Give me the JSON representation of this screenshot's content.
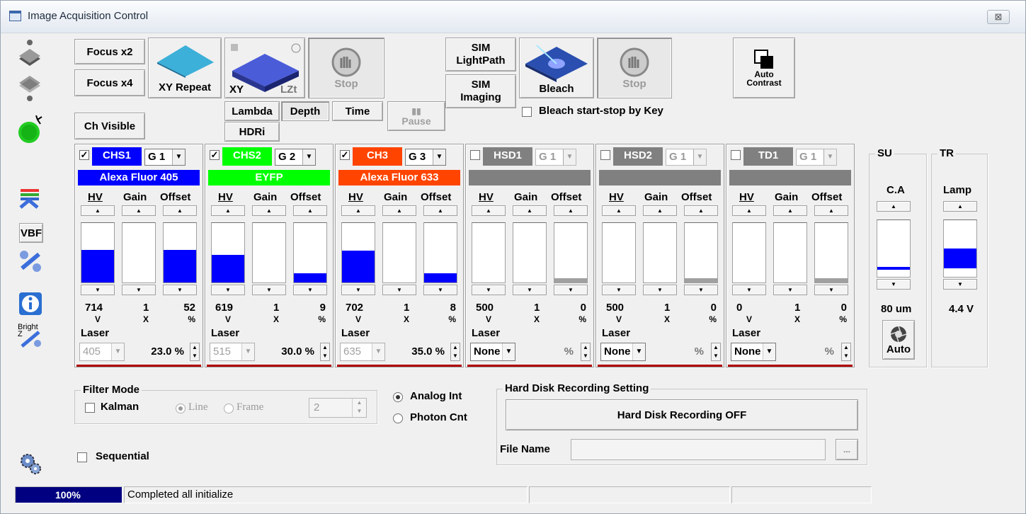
{
  "window": {
    "title": "Image Acquisition Control",
    "close_glyph": "⊠"
  },
  "toolbar": {
    "focus_x2": "Focus x2",
    "focus_x4": "Focus x4",
    "xy_repeat": "XY Repeat",
    "xy": "XY",
    "lzt": "LZt",
    "stop": "Stop",
    "sim_lightpath_1": "SIM",
    "sim_lightpath_2": "LightPath",
    "sim_imaging_1": "SIM",
    "sim_imaging_2": "Imaging",
    "bleach": "Bleach",
    "stop2": "Stop",
    "auto_contrast_1": "Auto",
    "auto_contrast_2": "Contrast",
    "lambda": "Lambda",
    "depth": "Depth",
    "time": "Time",
    "hdri": "HDRi",
    "pause": "Pause",
    "bleach_by_key": "Bleach start-stop by Key",
    "ch_visible": "Ch Visible"
  },
  "sidebar": {
    "vbf": "VBF",
    "bright_z": "Bright Z"
  },
  "columns": {
    "hv": "HV",
    "gain": "Gain",
    "offset": "Offset",
    "laser": "Laser",
    "unit_v": "V",
    "unit_x": "X",
    "unit_pct": "%"
  },
  "channels": [
    {
      "name": "CHS1",
      "checked": true,
      "group": "G 1",
      "dye": "Alexa Fluor 405",
      "color": "#0000ff",
      "dye_bg": "#0000ff",
      "dye_fg": "#ffffff",
      "hv": "714",
      "gain": "1",
      "offset": "52",
      "hv_fill": 0.55,
      "gain_fill": 0.0,
      "offset_fill": 0.55,
      "laser": "405",
      "laser_pct": "23.0 %",
      "enabled": true
    },
    {
      "name": "CHS2",
      "checked": true,
      "group": "G 2",
      "dye": "EYFP",
      "color": "#00ff00",
      "dye_bg": "#00ff00",
      "dye_fg": "#ffffff",
      "hv": "619",
      "gain": "1",
      "offset": "9",
      "hv_fill": 0.47,
      "gain_fill": 0.0,
      "offset_fill": 0.16,
      "laser": "515",
      "laser_pct": "30.0 %",
      "enabled": true
    },
    {
      "name": "CH3",
      "checked": true,
      "group": "G 3",
      "dye": "Alexa Fluor 633",
      "color": "#ff4400",
      "dye_bg": "#ff4400",
      "dye_fg": "#ffffff",
      "hv": "702",
      "gain": "1",
      "offset": "8",
      "hv_fill": 0.53,
      "gain_fill": 0.0,
      "offset_fill": 0.15,
      "laser": "635",
      "laser_pct": "35.0 %",
      "enabled": true
    },
    {
      "name": "HSD1",
      "checked": false,
      "group": "G 1",
      "dye": "",
      "color": "#808080",
      "dye_bg": "#808080",
      "dye_fg": "#ffffff",
      "hv": "500",
      "gain": "1",
      "offset": "0",
      "hv_fill": 0.0,
      "gain_fill": 0.0,
      "offset_fill": 0.07,
      "laser": "None",
      "laser_pct": "%",
      "enabled": false
    },
    {
      "name": "HSD2",
      "checked": false,
      "group": "G 1",
      "dye": "",
      "color": "#808080",
      "dye_bg": "#808080",
      "dye_fg": "#ffffff",
      "hv": "500",
      "gain": "1",
      "offset": "0",
      "hv_fill": 0.0,
      "gain_fill": 0.0,
      "offset_fill": 0.07,
      "laser": "None",
      "laser_pct": "%",
      "enabled": false
    },
    {
      "name": "TD1",
      "checked": false,
      "group": "G 1",
      "dye": "",
      "color": "#808080",
      "dye_bg": "#808080",
      "dye_fg": "#ffffff",
      "hv": "0",
      "gain": "1",
      "offset": "0",
      "hv_fill": 0.0,
      "gain_fill": 0.0,
      "offset_fill": 0.07,
      "laser": "None",
      "laser_pct": "%",
      "enabled": false
    }
  ],
  "su": {
    "group": "SU",
    "label": "C.A",
    "value": "80 um",
    "fill": 0.04,
    "auto": "Auto"
  },
  "tr": {
    "group": "TR",
    "label": "Lamp",
    "value": "4.4 V",
    "fill": 0.35
  },
  "filter": {
    "group": "Filter Mode",
    "kalman": "Kalman",
    "line": "Line",
    "frame": "Frame",
    "count": "2"
  },
  "mode": {
    "analog": "Analog Int",
    "photon": "Photon Cnt"
  },
  "sequential": "Sequential",
  "hdd": {
    "group": "Hard Disk Recording Setting",
    "button": "Hard Disk Recording OFF",
    "file_label": "File Name",
    "file_value": "",
    "browse": "..."
  },
  "status": {
    "progress": "100%",
    "progress_fraction": 1.0,
    "message": "Completed all initialize"
  }
}
